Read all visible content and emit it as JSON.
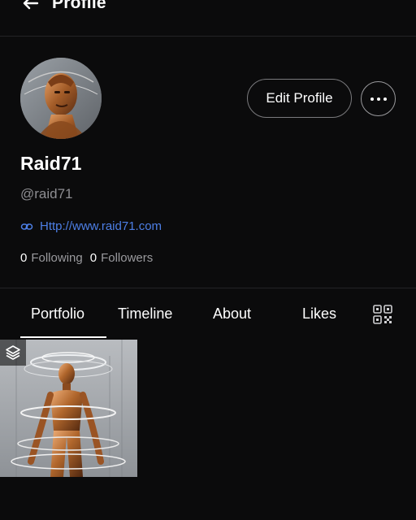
{
  "header": {
    "title": "Profile"
  },
  "profile": {
    "display_name": "Raid71",
    "handle": "@raid71",
    "website": "Http://www.raid71.com",
    "following_count": "0",
    "following_label": "Following",
    "followers_count": "0",
    "followers_label": "Followers",
    "edit_label": "Edit Profile"
  },
  "tabs": [
    {
      "label": "Portfolio",
      "active": true
    },
    {
      "label": "Timeline",
      "active": false
    },
    {
      "label": "About",
      "active": false
    },
    {
      "label": "Likes",
      "active": false
    }
  ],
  "icons": {
    "back": "arrow-left-icon",
    "more": "more-horizontal-icon",
    "link": "link-icon",
    "qr": "qr-code-icon",
    "layers": "layers-icon"
  },
  "colors": {
    "background": "#0b0b0c",
    "link": "#4d7fe6",
    "muted": "#8e8e92"
  }
}
